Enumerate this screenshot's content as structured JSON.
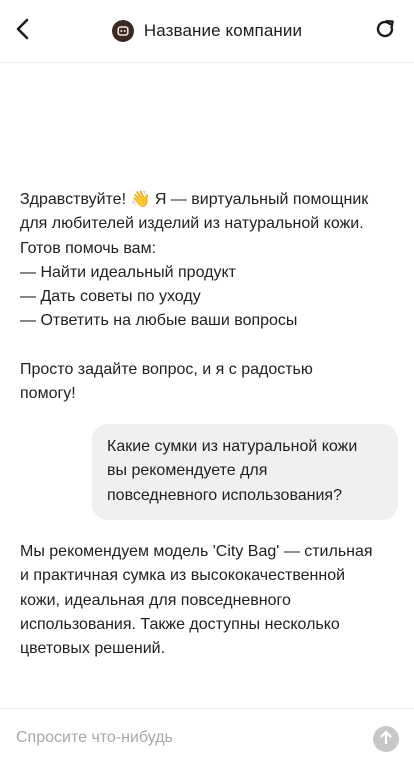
{
  "header": {
    "back_icon": "chevron-left-icon",
    "company_name": "Название компании",
    "logo_icon": "chat-bot-logo-icon",
    "refresh_icon": "refresh-icon"
  },
  "messages": {
    "greeting": {
      "lines": [
        "Здравствуйте! 👋 Я — виртуальный помощник",
        "для любителей изделий из натуральной кожи.",
        "Готов помочь вам:",
        "— Найти идеальный продукт",
        "— Дать советы по уходу",
        "— Ответить на любые ваши вопросы"
      ],
      "closing_lines": [
        "Просто задайте вопрос, и я с радостью",
        "помогу!"
      ]
    },
    "user_question": {
      "lines": [
        "Какие сумки из натуральной кожи",
        "вы рекомендуете для",
        "повседневного использования?"
      ]
    },
    "answer": {
      "lines": [
        "Мы рекомендуем модель 'City Bag' — стильная",
        "и практичная сумка из высококачественной",
        "кожи, идеальная для повседневного",
        "использования. Также доступны несколько",
        "цветовых решений."
      ]
    }
  },
  "composer": {
    "placeholder": "Спросите что-нибудь",
    "value": "",
    "send_icon": "arrow-up-icon"
  },
  "colors": {
    "user_bubble": "#eef0f2",
    "send_button_disabled": "#c8c8c8",
    "logo_background": "#3a2a22"
  }
}
